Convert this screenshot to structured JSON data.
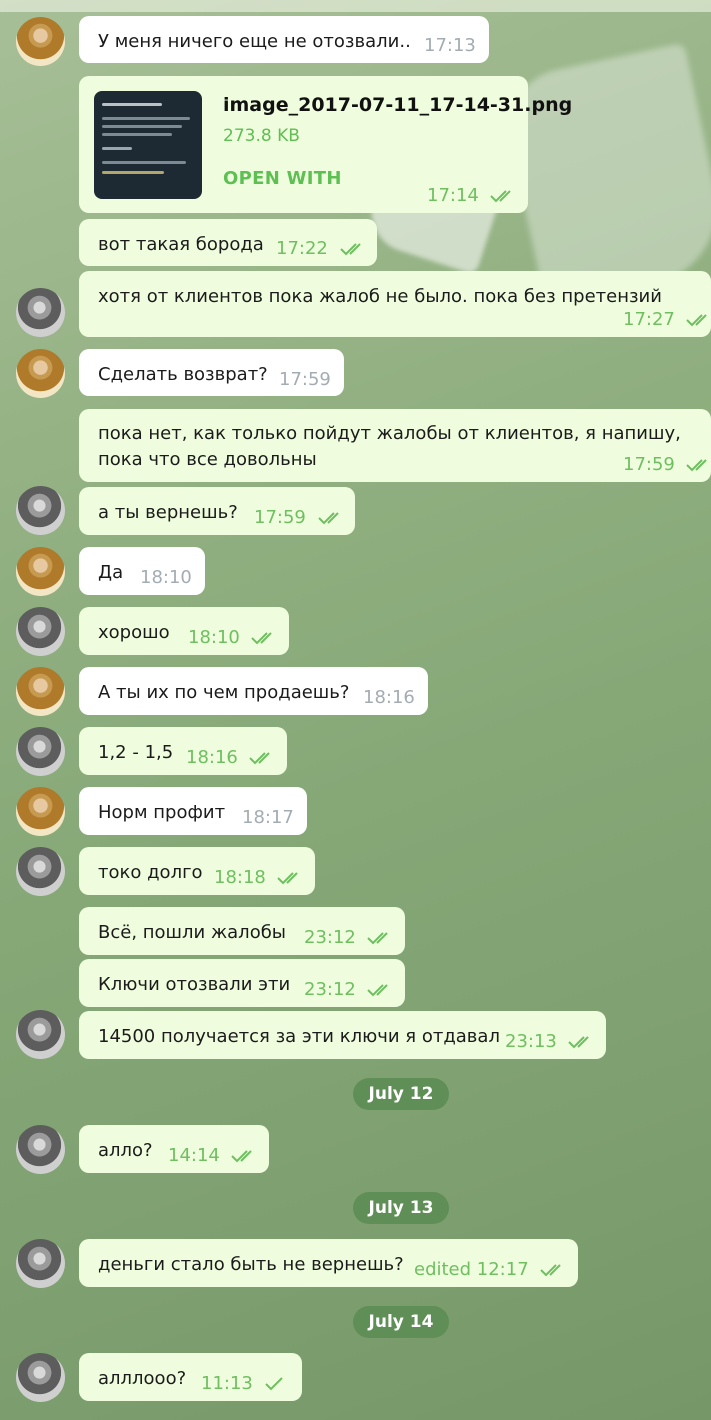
{
  "colors": {
    "outgoing_bubble": "#effdde",
    "incoming_bubble": "#ffffff",
    "read_check": "#6fbf61",
    "date_pill": "#5f8f56"
  },
  "file": {
    "name": "image_2017-07-11_17-14-31.png",
    "size": "273.8 KB",
    "open_label": "OPEN WITH",
    "time": "17:14"
  },
  "messages": [
    {
      "text": "У меня ничего еще не отозвали..",
      "time": "17:13"
    },
    {
      "text": "вот такая борода",
      "time": "17:22"
    },
    {
      "text": "хотя от клиентов пока жалоб не было. пока без претензий",
      "time": "17:27"
    },
    {
      "text": "Сделать возврат?",
      "time": "17:59"
    },
    {
      "text": "пока нет, как только пойдут жалобы от клиентов, я напишу, пока что все довольны",
      "time": "17:59"
    },
    {
      "text": "а ты вернешь?",
      "time": "17:59"
    },
    {
      "text": "Да",
      "time": "18:10"
    },
    {
      "text": "хорошо",
      "time": "18:10"
    },
    {
      "text": "А ты их по чем продаешь?",
      "time": "18:16"
    },
    {
      "text": "1,2 - 1,5",
      "time": "18:16"
    },
    {
      "text": "Норм профит",
      "time": "18:17"
    },
    {
      "text": "токо долго",
      "time": "18:18"
    },
    {
      "text": "Всё,  пошли жалобы",
      "time": "23:12"
    },
    {
      "text": "Ключи отозвали эти",
      "time": "23:12"
    },
    {
      "text": "14500 получается за эти ключи я отдавал",
      "time": "23:13"
    },
    {
      "text": "алло?",
      "time": "14:14"
    },
    {
      "text": "деньги стало быть не вернешь?",
      "time": "edited 12:17"
    },
    {
      "text": "алллооо?",
      "time": "11:13"
    }
  ],
  "dates": [
    "July 12",
    "July 13",
    "July 14"
  ]
}
